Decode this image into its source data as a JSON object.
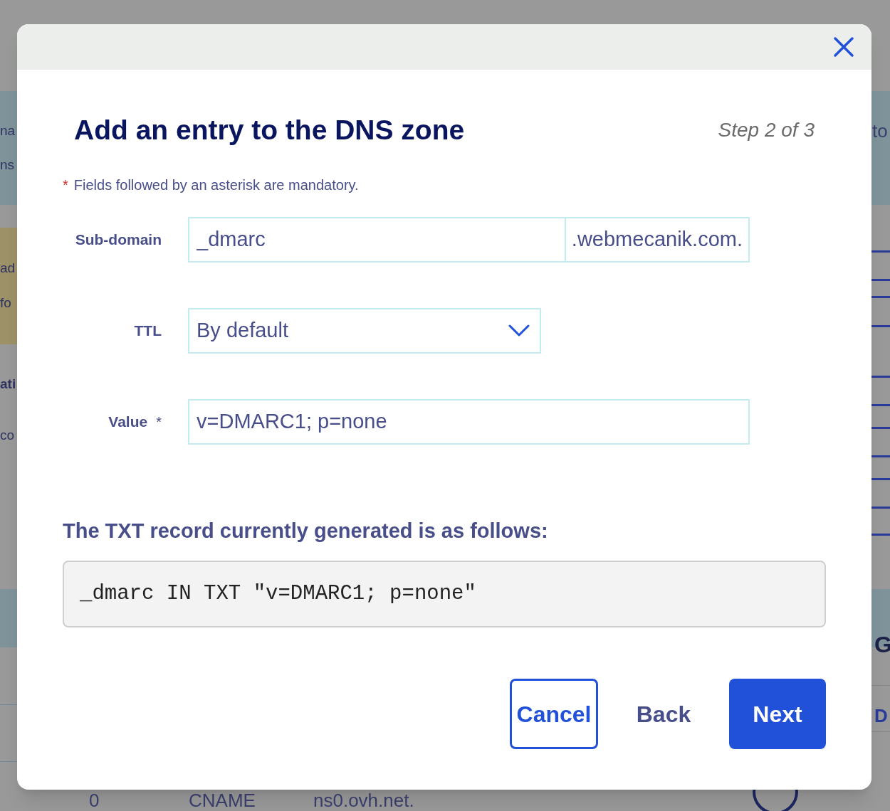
{
  "background": {
    "left_fragments": [
      "na",
      "ns",
      "ad",
      "fo",
      "ati",
      "co"
    ],
    "right_fragments": [
      "to",
      "G",
      "D"
    ],
    "table_row": [
      "0",
      "CNAME",
      "ns0.ovh.net."
    ]
  },
  "dialog": {
    "title": "Add an entry to the DNS zone",
    "step": "Step 2 of 3",
    "notice": {
      "mark": "*",
      "text": "Fields followed by an asterisk are mandatory."
    },
    "fields": [
      {
        "kind": "text",
        "label": "Sub-domain",
        "value": "_dmarc",
        "suffix": ".webmecanik.com."
      },
      {
        "kind": "select",
        "label": "TTL",
        "value": "By default"
      },
      {
        "kind": "text",
        "label": "Value",
        "required_mark": "*",
        "value": "v=DMARC1; p=none"
      }
    ],
    "preview_heading": "The TXT record currently generated is as follows:",
    "preview": "_dmarc IN TXT \"v=DMARC1; p=none\"",
    "buttons": [
      {
        "kind": "outline",
        "label": "Cancel"
      },
      {
        "kind": "text",
        "label": "Back"
      },
      {
        "kind": "primary",
        "label": "Next"
      }
    ]
  }
}
